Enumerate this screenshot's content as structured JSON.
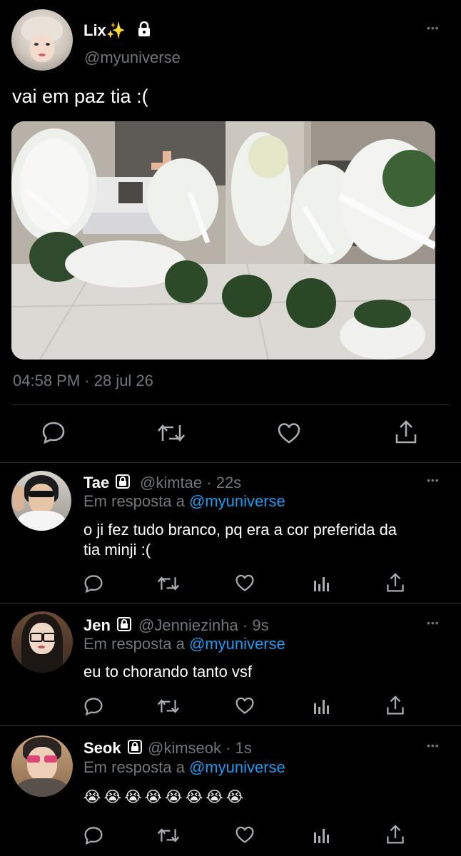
{
  "main_tweet": {
    "author_name": "Lix✨",
    "handle": "@myuniverse",
    "text": "vai em paz tia :(",
    "timestamp": "04:58 PM · 28 jul 26"
  },
  "replies": [
    {
      "name": "Tae",
      "handle": "@kimtae",
      "time": "· 22s",
      "reply_prefix": "Em resposta a",
      "reply_to": "@myuniverse",
      "text_line1": "o ji fez tudo branco, pq era a cor preferida da",
      "text_line2": "tia minji :("
    },
    {
      "name": "Jen",
      "handle": "@Jenniezinha",
      "time": "· 9s",
      "reply_prefix": "Em resposta a",
      "reply_to": "@myuniverse",
      "text_line1": "eu to chorando tanto vsf"
    },
    {
      "name": "Seok",
      "handle": "@kimseok",
      "time": "· 1s",
      "reply_prefix": "Em resposta a",
      "reply_to": "@myuniverse",
      "text_line1": "😭😭😭😭😭😭😭😭"
    }
  ],
  "more_icon": "•••",
  "icons": [
    "reply-icon",
    "retweet-icon",
    "like-icon",
    "analytics-icon",
    "share-icon",
    "lock-icon"
  ],
  "colors": {
    "accent": "#1d9bf0",
    "muted": "#71767b",
    "divider": "#2f3336",
    "background": "#000000"
  }
}
